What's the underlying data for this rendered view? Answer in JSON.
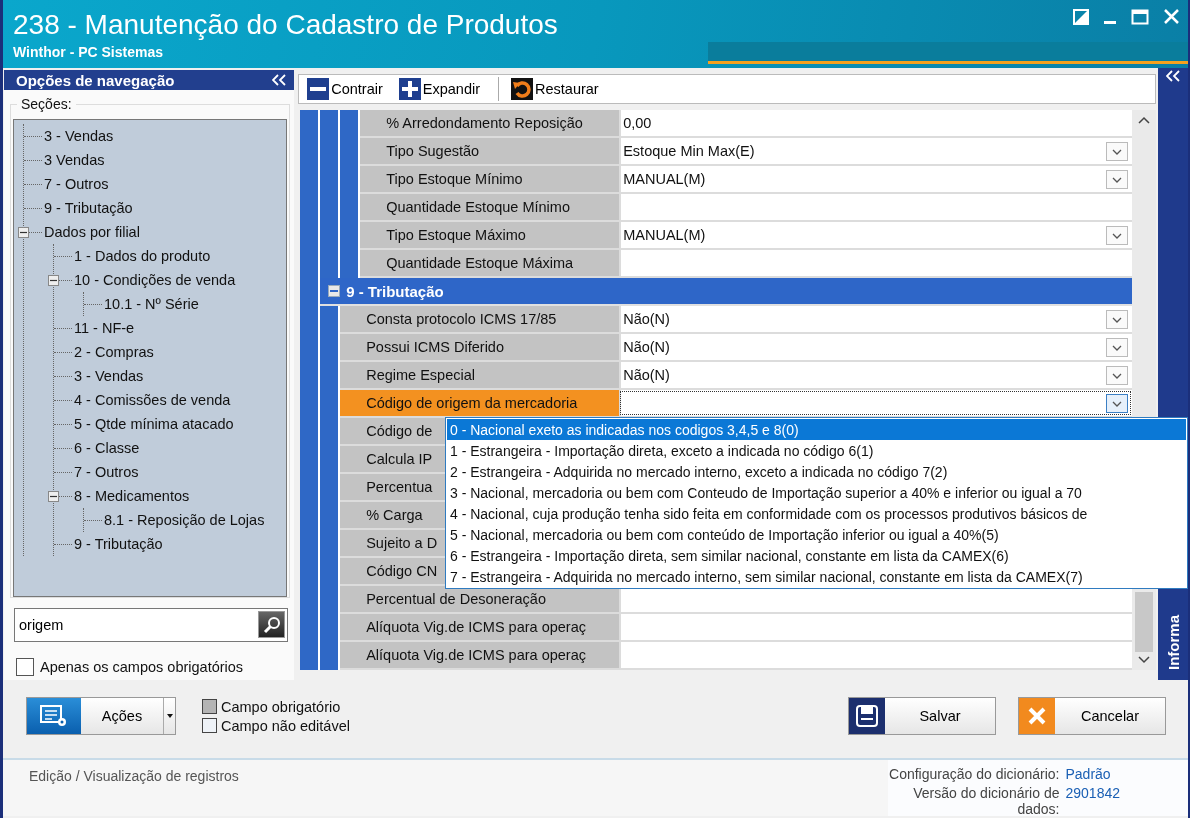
{
  "window": {
    "title": "238 - Manutenção do Cadastro de Produtos",
    "subtitle": "Winthor - PC Sistemas"
  },
  "navigation": {
    "title": "Opções de navegação",
    "sections_label": "Seções:",
    "tree": [
      {
        "label": "3 - Vendas"
      },
      {
        "label": "3 Vendas"
      },
      {
        "label": "7 - Outros"
      },
      {
        "label": "9 - Tributação"
      },
      {
        "label": "Dados por filial",
        "expanded": true,
        "children": [
          {
            "label": "1 - Dados do produto"
          },
          {
            "label": "10 - Condições de venda",
            "expanded": true,
            "children": [
              {
                "label": "10.1 - Nº Série"
              }
            ]
          },
          {
            "label": "11 - NF-e"
          },
          {
            "label": "2 - Compras"
          },
          {
            "label": "3 - Vendas"
          },
          {
            "label": "4 - Comissões de venda"
          },
          {
            "label": "5 - Qtde mínima atacado"
          },
          {
            "label": "6 - Classe"
          },
          {
            "label": "7 - Outros"
          },
          {
            "label": "8 - Medicamentos",
            "expanded": true,
            "children": [
              {
                "label": "8.1 -  Reposição de Lojas"
              }
            ]
          },
          {
            "label": "9 - Tributação"
          }
        ]
      }
    ],
    "search": {
      "value": "origem"
    },
    "required_only": {
      "label": "Apenas os campos obrigatórios",
      "checked": false
    }
  },
  "toolbar": [
    {
      "label": "Contrair",
      "kind": "collapse"
    },
    {
      "label": "Expandir",
      "kind": "expand"
    },
    {
      "label": "Restaurar",
      "kind": "restore"
    }
  ],
  "grid": {
    "groups": [
      {
        "children": [
          {
            "rows": [
              {
                "label": "% Arredondamento Reposição",
                "value": "0,00",
                "selected": false
              },
              {
                "label": "Tipo Sugestão",
                "value": "Estoque Min Max(E)",
                "dropdown": true,
                "selected": false
              },
              {
                "label": "Tipo Estoque Mínimo",
                "value": "MANUAL(M)",
                "dropdown": true,
                "selected": false
              },
              {
                "label": "Quantidade Estoque Mínimo",
                "selected": false
              },
              {
                "label": "Tipo Estoque Máximo",
                "value": "MANUAL(M)",
                "dropdown": true,
                "selected": false
              },
              {
                "label": "Quantidade Estoque Máxima",
                "selected": false
              }
            ]
          }
        ]
      },
      {
        "title": "9 - Tributação",
        "expanded": true,
        "rows": [
          {
            "label": "Consta protocolo ICMS 17/85",
            "value": "Não(N)",
            "dropdown": true,
            "selected": false
          },
          {
            "label": "Possui ICMS Diferido",
            "value": "Não(N)",
            "dropdown": true,
            "selected": false
          },
          {
            "label": "Regime Especial",
            "value": "Não(N)",
            "dropdown": true,
            "selected": false
          },
          {
            "label": "Código de origem da mercadoria",
            "dropdown": true,
            "selected": true
          },
          {
            "label": "Código de",
            "selected": false
          },
          {
            "label": "Calcula IP",
            "selected": false
          },
          {
            "label": "Percentua",
            "selected": false
          },
          {
            "label": "% Carga",
            "selected": false
          },
          {
            "label": "Sujeito a D",
            "selected": false
          },
          {
            "label": "Código CN",
            "selected": false
          },
          {
            "label": "Percentual de Desoneração",
            "selected": false
          },
          {
            "label": "Alíquota Vig.de ICMS para operaç",
            "selected": false
          },
          {
            "label": "Alíquota Vig.de ICMS para operaç",
            "selected": false
          }
        ]
      }
    ]
  },
  "dropdown": {
    "options": [
      {
        "label": "0 - Nacional exeto as indicadas nos codigos 3,4,5 e 8(0)",
        "selected": true
      },
      {
        "label": "1 - Estrangeira - Importação direta, exceto a indicada no código 6(1)",
        "selected": false
      },
      {
        "label": "2 - Estrangeira - Adquirida no mercado interno, exceto a indicada no código 7(2)",
        "selected": false
      },
      {
        "label": "3 - Nacional, mercadoria ou bem com Conteudo de Importação superior a 40% e inferior ou igual a 70",
        "selected": false
      },
      {
        "label": "4 - Nacional, cuja produção tenha sido feita em conformidade com os processos produtivos básicos de",
        "selected": false
      },
      {
        "label": "5 - Nacional, mercadoria ou bem com conteúdo de Importação inferior ou igual a 40%(5)",
        "selected": false
      },
      {
        "label": "6 - Estrangeira - Importação direta, sem similar nacional, constante em lista da CAMEX(6)",
        "selected": false
      },
      {
        "label": "7 - Estrangeira - Adquirida no mercado interno, sem similar nacional, constante em lista da CAMEX(7)",
        "selected": false
      }
    ]
  },
  "side_panel": {
    "title": "Informa"
  },
  "actions_button": {
    "label": "Ações"
  },
  "legend": [
    {
      "label": "Campo obrigatório",
      "kind": "required"
    },
    {
      "label": "Campo não editável",
      "kind": "readonly"
    }
  ],
  "buttons": [
    {
      "label": "Salvar",
      "kind": "save"
    },
    {
      "label": "Cancelar",
      "kind": "cancel"
    }
  ],
  "status_bar": {
    "text": "Edição / Visualização de registros",
    "info": [
      {
        "label": "Configuração do dicionário:",
        "value": "Padrão"
      },
      {
        "label": "Versão do dicionário de dados:",
        "value": "2901842"
      }
    ]
  }
}
